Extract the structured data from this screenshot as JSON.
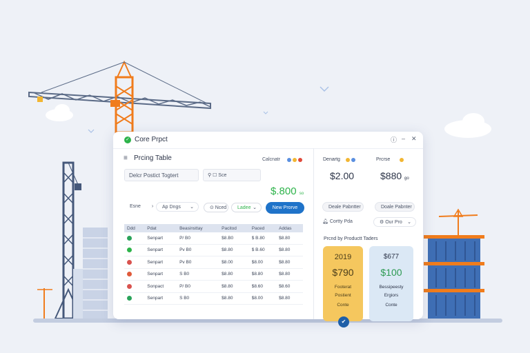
{
  "window": {
    "title": "Core Prpct",
    "help_icon": "help-icon",
    "minimize_icon": "minimize-icon",
    "close_icon": "close-icon"
  },
  "left": {
    "title": "Prcing Table",
    "header_label": "Calcnatr",
    "status_dots": [
      "#5a8fe0",
      "#f2b632",
      "#e0493a"
    ],
    "field_product": "Delcr Postict Togtert",
    "field_filter": "⚲ ☐ Sce",
    "price": "$.800",
    "price_suffix": "so",
    "select_1": "Esne",
    "select_1_arrow": "›",
    "select_2": "Ap Dngs",
    "pill_1": "⊙ Nced",
    "pill_2": "Ladee",
    "primary_button": "New Prorve",
    "table": {
      "headers": [
        "Ddd",
        "Pdat",
        "Beasinsttay",
        "Pacitod",
        "Paced",
        "Addas"
      ],
      "rows": [
        {
          "icon_color": "#2aa35a",
          "name": "Senpart",
          "c1": "P/ B0",
          "c2": "$8.B0",
          "c3": "$ B.80",
          "c4": "$8.80"
        },
        {
          "icon_color": "#2db34a",
          "name": "Senpart",
          "c1": "Pv B0",
          "c2": "$8.80",
          "c3": "$ B.60",
          "c4": "$8.80"
        },
        {
          "icon_color": "#d9534f",
          "name": "Senpart",
          "c1": "Pv B0",
          "c2": "$8.00",
          "c3": "$8.00",
          "c4": "$8.80"
        },
        {
          "icon_color": "#e05a3a",
          "name": "Senpart",
          "c1": "S B0",
          "c2": "$8.80",
          "c3": "$8.80",
          "c4": "$8.80"
        },
        {
          "icon_color": "#d9534f",
          "name": "Sonpact",
          "c1": "P/ B0",
          "c2": "$8.80",
          "c3": "$8.60",
          "c4": "$8.60"
        },
        {
          "icon_color": "#2aa35a",
          "name": "Senpart",
          "c1": "S B0",
          "c2": "$8.80",
          "c3": "$8.00",
          "c4": "$8.80"
        }
      ]
    }
  },
  "right": {
    "col1_label": "Denartg",
    "col1_price": "$2.00",
    "col1_button": "Deale Pabntter",
    "col2_label": "Prcrse",
    "col2_price": "$880",
    "col2_suffix": "go",
    "col2_button": "Doale Pabnter",
    "select_a": "Cortty Pda",
    "select_b": "Our Pro",
    "section_title": "Prcnd by Productt Taders",
    "card_yellow": {
      "top": "2019",
      "price": "$790",
      "line1": "Footerat",
      "line2": "Postient",
      "line3": "Conte",
      "color": "#f5c75e"
    },
    "card_blue": {
      "top": "$677",
      "price": "$100",
      "line1": "Bessipeesty",
      "line2": "Ergiors",
      "line3": "Conte",
      "color": "#dbe8f5"
    }
  },
  "colors": {
    "accent": "#1f73c9",
    "positive": "#2db34a",
    "crane": "#f07c1c"
  }
}
